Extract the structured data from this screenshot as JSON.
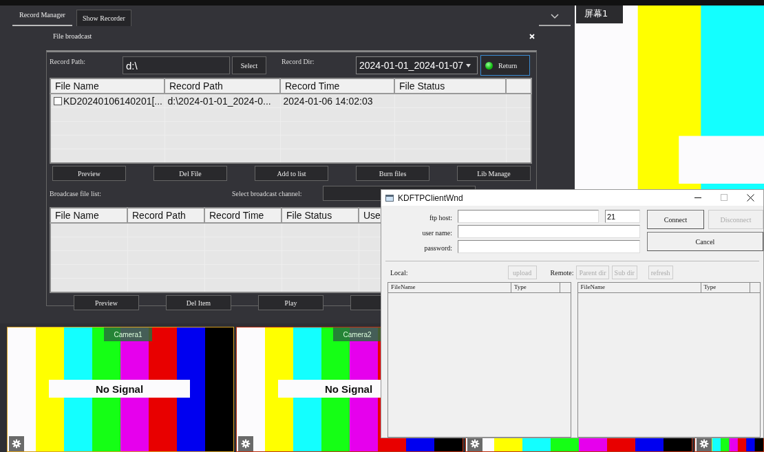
{
  "tabs": [
    {
      "label": "Record Manager",
      "selected": true
    },
    {
      "label": "Show Recorder",
      "selected": false
    }
  ],
  "panel_title": "File broadcast",
  "record_path": {
    "label": "Record Path:",
    "value": "d:\\"
  },
  "select_button": "Select",
  "record_dir": {
    "label": "Record Dir:",
    "value": "2024-01-01_2024-01-07"
  },
  "return_button": "Return",
  "record_table": {
    "columns": [
      "File Name",
      "Record Path",
      "Record Time",
      "File Status"
    ],
    "rows": [
      {
        "checked": false,
        "cells": [
          "KD20240106140201[...",
          "d:\\2024-01-01_2024-0...",
          "2024-01-06 14:02:03"
        ]
      }
    ]
  },
  "record_buttons": [
    "Preview",
    "Del File",
    "Add to list",
    "Burn files",
    "Lib Manage"
  ],
  "broadcast_label": "Broadcase file list:",
  "channel_label": "Select broadcast channel:",
  "broadcast_table": {
    "columns": [
      "File Name",
      "Record Path",
      "Record Time",
      "File Status",
      "Use"
    ]
  },
  "broadcast_buttons": [
    "Preview",
    "Del Item",
    "Play"
  ],
  "preview": {
    "tab": "屏幕1"
  },
  "cameras": [
    {
      "label": "Camera1",
      "message": "No Signal",
      "selected": true
    },
    {
      "label": "Camera2",
      "message": "No Signal",
      "selected": false
    },
    {
      "selected": false
    },
    {
      "selected": false
    }
  ],
  "ftp": {
    "title": "KDFTPClientWnd",
    "host_label": "ftp host:",
    "port": "21",
    "user_label": "user name:",
    "password_label": "password:",
    "buttons": [
      {
        "label": "Connect",
        "disabled": false
      },
      {
        "label": "Disconnect",
        "disabled": true
      },
      {
        "label": "Cancel",
        "disabled": false
      }
    ],
    "local_label": "Local:",
    "upload": {
      "label": "upload",
      "disabled": true
    },
    "remote_label": "Remote:",
    "remote_buttons": [
      {
        "label": "Parent dir",
        "disabled": true
      },
      {
        "label": "Sub dir",
        "disabled": true
      },
      {
        "label": "refresh",
        "disabled": true
      }
    ],
    "local_columns": [
      "FileName",
      "Type"
    ],
    "remote_columns": [
      "FileName",
      "Type"
    ]
  }
}
